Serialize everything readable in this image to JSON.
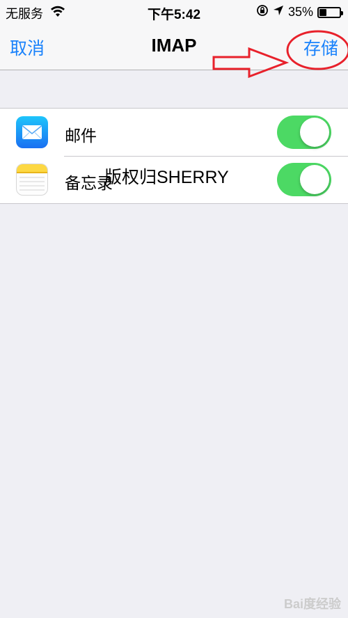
{
  "status_bar": {
    "carrier": "无服务",
    "time": "下午5:42",
    "battery_percent": "35%",
    "battery_level": 0.35
  },
  "navbar": {
    "cancel_label": "取消",
    "title": "IMAP",
    "save_label": "存储"
  },
  "list": {
    "items": [
      {
        "label": "邮件",
        "icon": "mail-icon",
        "toggle_on": true
      },
      {
        "label": "备忘录",
        "icon": "notes-icon",
        "toggle_on": true
      }
    ]
  },
  "watermark": "版权归SHERRY",
  "baidu_logo": "Bai度经验",
  "colors": {
    "accent": "#1a82fb",
    "toggle_on": "#4cd964",
    "annotation": "#e8212b",
    "background": "#efeff4"
  }
}
